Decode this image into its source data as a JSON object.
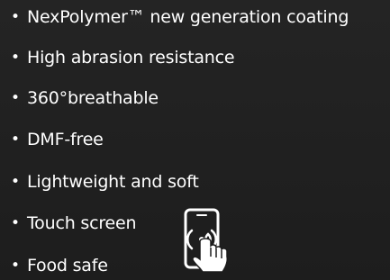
{
  "features": [
    {
      "text": "NexPolymer™ new generation coating"
    },
    {
      "text": "High abrasion resistance"
    },
    {
      "text": "360°breathable"
    },
    {
      "text": "DMF-free"
    },
    {
      "text": "Lightweight and soft"
    },
    {
      "text": "Touch screen"
    },
    {
      "text": "Food safe"
    }
  ],
  "bullet": "•",
  "icons": {
    "touch": "touch-screen-phone-icon"
  },
  "colors": {
    "background": "#1f1f1f",
    "text": "#ffffff"
  }
}
